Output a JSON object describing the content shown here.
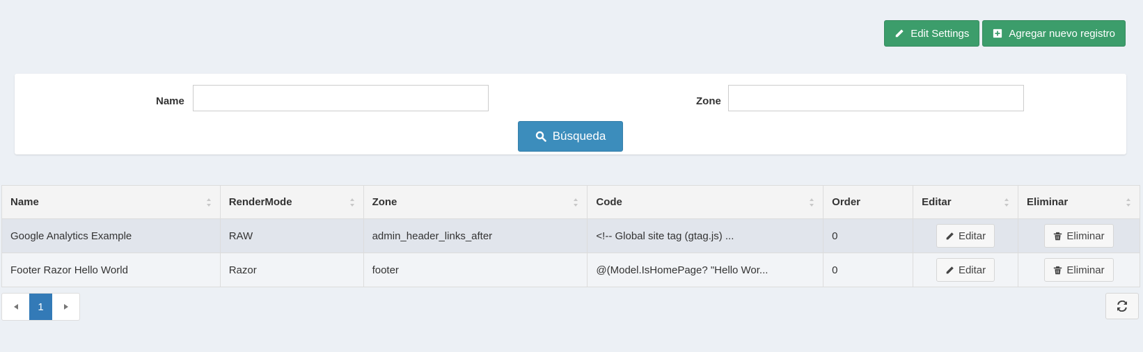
{
  "toolbar": {
    "edit_settings_label": "Edit Settings",
    "add_new_label": "Agregar nuevo registro",
    "accent_color": "#3c9d6b"
  },
  "search": {
    "name_label": "Name",
    "name_value": "",
    "zone_label": "Zone",
    "zone_value": "",
    "search_button_label": "Búsqueda",
    "search_button_color": "#3c8dbc"
  },
  "grid": {
    "columns": [
      "Name",
      "RenderMode",
      "Zone",
      "Code",
      "Order",
      "Editar",
      "Eliminar"
    ],
    "rows": [
      {
        "name": "Google Analytics Example",
        "render_mode": "RAW",
        "zone": "admin_header_links_after",
        "code": "<!-- Global site tag (gtag.js) ...",
        "order": "0",
        "edit_label": "Editar",
        "delete_label": "Eliminar"
      },
      {
        "name": "Footer Razor Hello World",
        "render_mode": "Razor",
        "zone": "footer",
        "code": "@(Model.IsHomePage? \"Hello Wor...",
        "order": "0",
        "edit_label": "Editar",
        "delete_label": "Eliminar"
      }
    ]
  },
  "pager": {
    "current_page": "1"
  },
  "icons": {
    "edit": "pencil-icon",
    "add": "plus-square-icon",
    "search": "search-icon",
    "delete": "trash-icon",
    "prev": "caret-left-icon",
    "next": "caret-right-icon",
    "refresh": "refresh-icon",
    "sort": "sort-icon"
  }
}
